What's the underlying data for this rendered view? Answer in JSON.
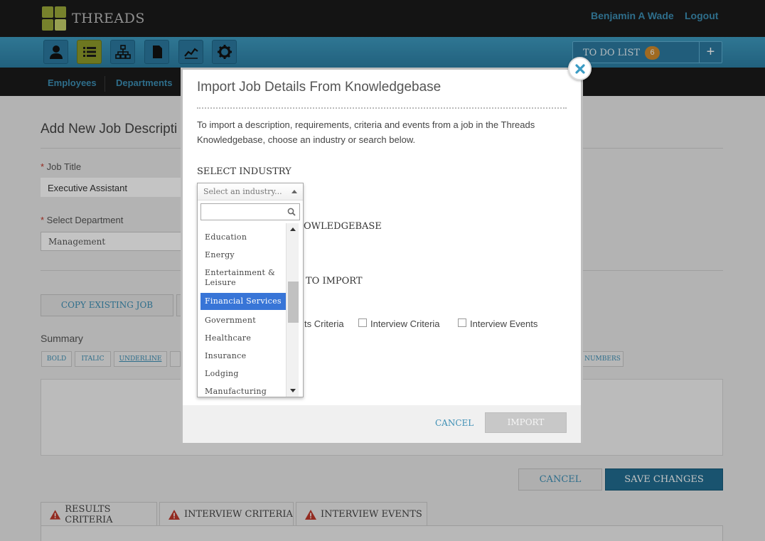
{
  "app": {
    "brand": "THREADS",
    "user_name": "Benjamin A Wade",
    "logout": "Logout"
  },
  "toolbar": {
    "icons": [
      "person-icon",
      "list-icon",
      "org-chart-icon",
      "document-icon",
      "chart-icon",
      "gear-icon"
    ],
    "active_index": 1,
    "todo_label": "TO DO LIST",
    "todo_count": "6",
    "todo_add": "+"
  },
  "subnav": {
    "employees": "Employees",
    "departments": "Departments"
  },
  "page": {
    "title": "Add New Job Descripti",
    "job_title_label": "Job Title",
    "job_title_value": "Executive Assistant",
    "department_label": "Select Department",
    "department_value": "Management",
    "copy_existing": "COPY EXISTING JOB",
    "summary_label": "Summary",
    "format_bold": "BOLD",
    "format_italic": "ITALIC",
    "format_underline": "UNDERLINE",
    "format_numbers": "NUMBERS",
    "cancel": "CANCEL",
    "save": "SAVE CHANGES",
    "tabs": {
      "results": "RESULTS CRITERIA",
      "interview": "INTERVIEW CRITERIA",
      "events": "INTERVIEW EVENTS"
    }
  },
  "dialog": {
    "title": "Import Job Details From Knowledgebase",
    "intro": "To import a description, requirements, criteria and events from a job in the Threads Knowledgebase, choose an industry or search below.",
    "select_industry": "SELECT INDUSTRY",
    "knowledgebase_partial": "OWLEDGEBASE",
    "to_import_partial": "TO IMPORT",
    "checkbox_results_partial": "ts Criteria",
    "checkbox_interview_criteria": "Interview Criteria",
    "checkbox_interview_events": "Interview Events",
    "cancel": "CANCEL",
    "import": "IMPORT"
  },
  "dropdown": {
    "placeholder": "Select an industry...",
    "search_value": "",
    "selected": "Financial Services",
    "options": [
      "Education",
      "Energy",
      "Entertainment & Leisure",
      "Financial Services",
      "Government",
      "Healthcare",
      "Insurance",
      "Lodging",
      "Manufacturing"
    ]
  },
  "colors": {
    "accent": "#3d8fb5",
    "toolbar": "#2c7ea4",
    "active_icon": "#8e9b2a",
    "save_button": "#216d91",
    "selected_option": "#3875d7",
    "warning": "#c0392b"
  }
}
